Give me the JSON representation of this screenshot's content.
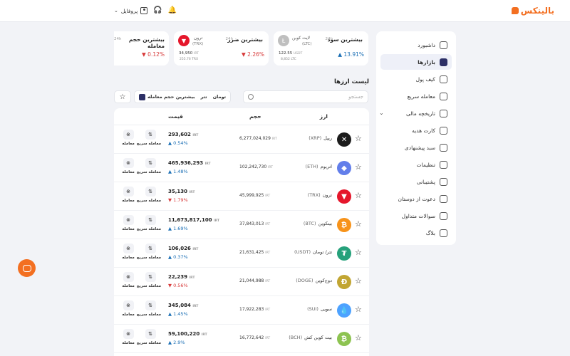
{
  "brand": {
    "name": "بالینکس",
    "accent": "#f36f21",
    "primary": "#2c2f66"
  },
  "topbar": {
    "profile_label": "پروفایل",
    "icons": [
      "user-icon",
      "headset-icon",
      "bell-icon"
    ]
  },
  "sidebar": {
    "items": [
      {
        "label": "داشبورد",
        "icon": "dashboard-icon"
      },
      {
        "label": "بازارها",
        "icon": "markets-icon",
        "active": true
      },
      {
        "label": "کیف پول",
        "icon": "wallet-icon"
      },
      {
        "label": "معامله سریع",
        "icon": "swap-icon"
      },
      {
        "label": "تاریخچه مالی",
        "icon": "history-icon",
        "expandable": true
      },
      {
        "label": "کارت هدیه",
        "icon": "gift-icon"
      },
      {
        "label": "سبد پیشنهادی",
        "icon": "basket-icon"
      },
      {
        "label": "تنظیمات",
        "icon": "gear-icon"
      },
      {
        "label": "پشتیبانی",
        "icon": "headset-icon"
      },
      {
        "label": "دعوت از دوستان",
        "icon": "invite-icon"
      },
      {
        "label": "سوالات متداول",
        "icon": "faq-icon"
      },
      {
        "label": "بلاگ",
        "icon": "blog-icon"
      }
    ]
  },
  "stats": [
    {
      "title": "بیشترین سود",
      "period": "24h",
      "coin": "لایت کوین",
      "symbol": "(LTC)",
      "price": "122.55",
      "price_unit": "USDT",
      "volume": "8,852 LTC",
      "change": "13.91%",
      "direction": "up",
      "color": "#bfbfbf",
      "glyph": "Ł"
    },
    {
      "title": "بیشترین ضرر",
      "period": "24h",
      "coin": "ترون",
      "symbol": "(TRX)",
      "price": "34,950",
      "price_unit": "IRT",
      "volume": "255.76 TRX",
      "change": "2.26%",
      "direction": "down",
      "color": "#e5162b",
      "glyph": "▼"
    },
    {
      "title": "بیشترین حجم معامله",
      "period": "24h",
      "change": "0.12%",
      "direction": "down"
    }
  ],
  "list": {
    "title": "لیست ارزها",
    "search_placeholder": "جستجو",
    "sort_label": "بیشترین حجم معامله",
    "tabs": [
      "تتر",
      "تومان"
    ],
    "headers": {
      "asset": "ارز",
      "volume": "حجم",
      "price": "قیمت"
    },
    "price_unit": "IRT",
    "actions": {
      "quick_trade": "معامله سریع",
      "trade": "معامله"
    },
    "rows": [
      {
        "name": "ریپل",
        "symbol": "(XRP)",
        "volume": "6,277,024,029",
        "price": "293,602",
        "change": "0.54%",
        "direction": "up",
        "color": "#1c1c1c",
        "glyph": "✕"
      },
      {
        "name": "اتریوم",
        "symbol": "(ETH)",
        "volume": "102,242,730",
        "price": "465,936,293",
        "change": "1.48%",
        "direction": "up",
        "color": "#627eea",
        "glyph": "◆"
      },
      {
        "name": "ترون",
        "symbol": "(TRX)",
        "volume": "45,999,925",
        "price": "35,130",
        "change": "1.79%",
        "direction": "down",
        "color": "#e5162b",
        "glyph": "▼"
      },
      {
        "name": "بیتکوین",
        "symbol": "(BTC)",
        "volume": "37,843,013",
        "price": "11,673,817,100",
        "change": "1.69%",
        "direction": "up",
        "color": "#f7931a",
        "glyph": "₿"
      },
      {
        "name": "تتر/ تومان",
        "symbol": "(USDT)",
        "volume": "21,631,425",
        "price": "106,026",
        "change": "0.37%",
        "direction": "up",
        "color": "#26a17b",
        "glyph": "₮"
      },
      {
        "name": "دوج‌کوین",
        "symbol": "(DOGE)",
        "volume": "21,044,988",
        "price": "22,239",
        "change": "0.56%",
        "direction": "down",
        "color": "#c2a633",
        "glyph": "Ð"
      },
      {
        "name": "سویی",
        "symbol": "(SUI)",
        "volume": "17,922,283",
        "price": "345,084",
        "change": "1.45%",
        "direction": "up",
        "color": "#4da2ff",
        "glyph": "💧"
      },
      {
        "name": "بیت کوین کش",
        "symbol": "(BCH)",
        "volume": "16,772,642",
        "price": "59,100,220",
        "change": "2.9%",
        "direction": "up",
        "color": "#8dc351",
        "glyph": "₿"
      }
    ]
  }
}
